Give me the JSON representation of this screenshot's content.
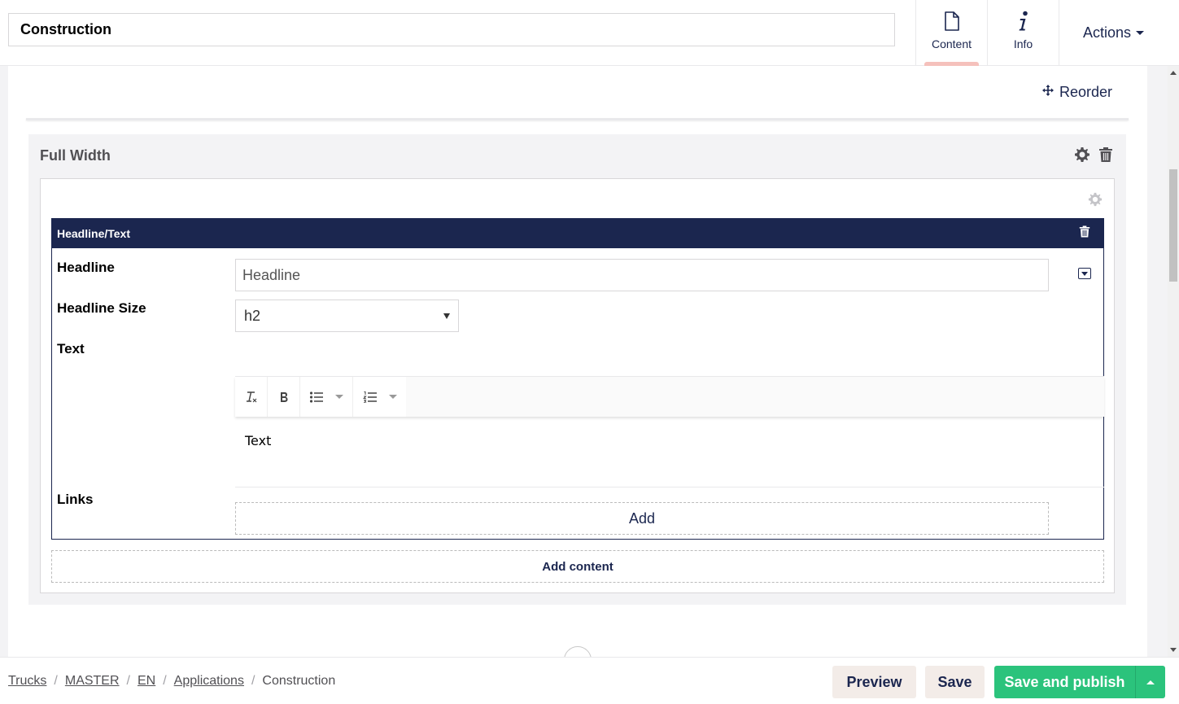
{
  "header": {
    "node_name": "Construction",
    "tabs": [
      {
        "label": "Content",
        "icon": "document-icon"
      },
      {
        "label": "Info",
        "icon": "info-icon"
      }
    ],
    "actions_label": "Actions"
  },
  "toolbar": {
    "reorder_label": "Reorder"
  },
  "section": {
    "title": "Full Width",
    "block": {
      "title": "Headline/Text",
      "fields": {
        "headline_label": "Headline",
        "headline_placeholder": "Headline",
        "size_label": "Headline Size",
        "size_value": "h2",
        "text_label": "Text",
        "text_value": "Text",
        "links_label": "Links",
        "links_add": "Add"
      }
    },
    "add_content_label": "Add content"
  },
  "footer": {
    "breadcrumb": [
      "Trucks",
      "MASTER",
      "EN",
      "Applications",
      "Construction"
    ],
    "preview_label": "Preview",
    "save_label": "Save",
    "publish_label": "Save and publish"
  },
  "colors": {
    "brand": "#1b264f",
    "publish": "#2bc37c",
    "tab_indicator": "#f5c1bc"
  }
}
